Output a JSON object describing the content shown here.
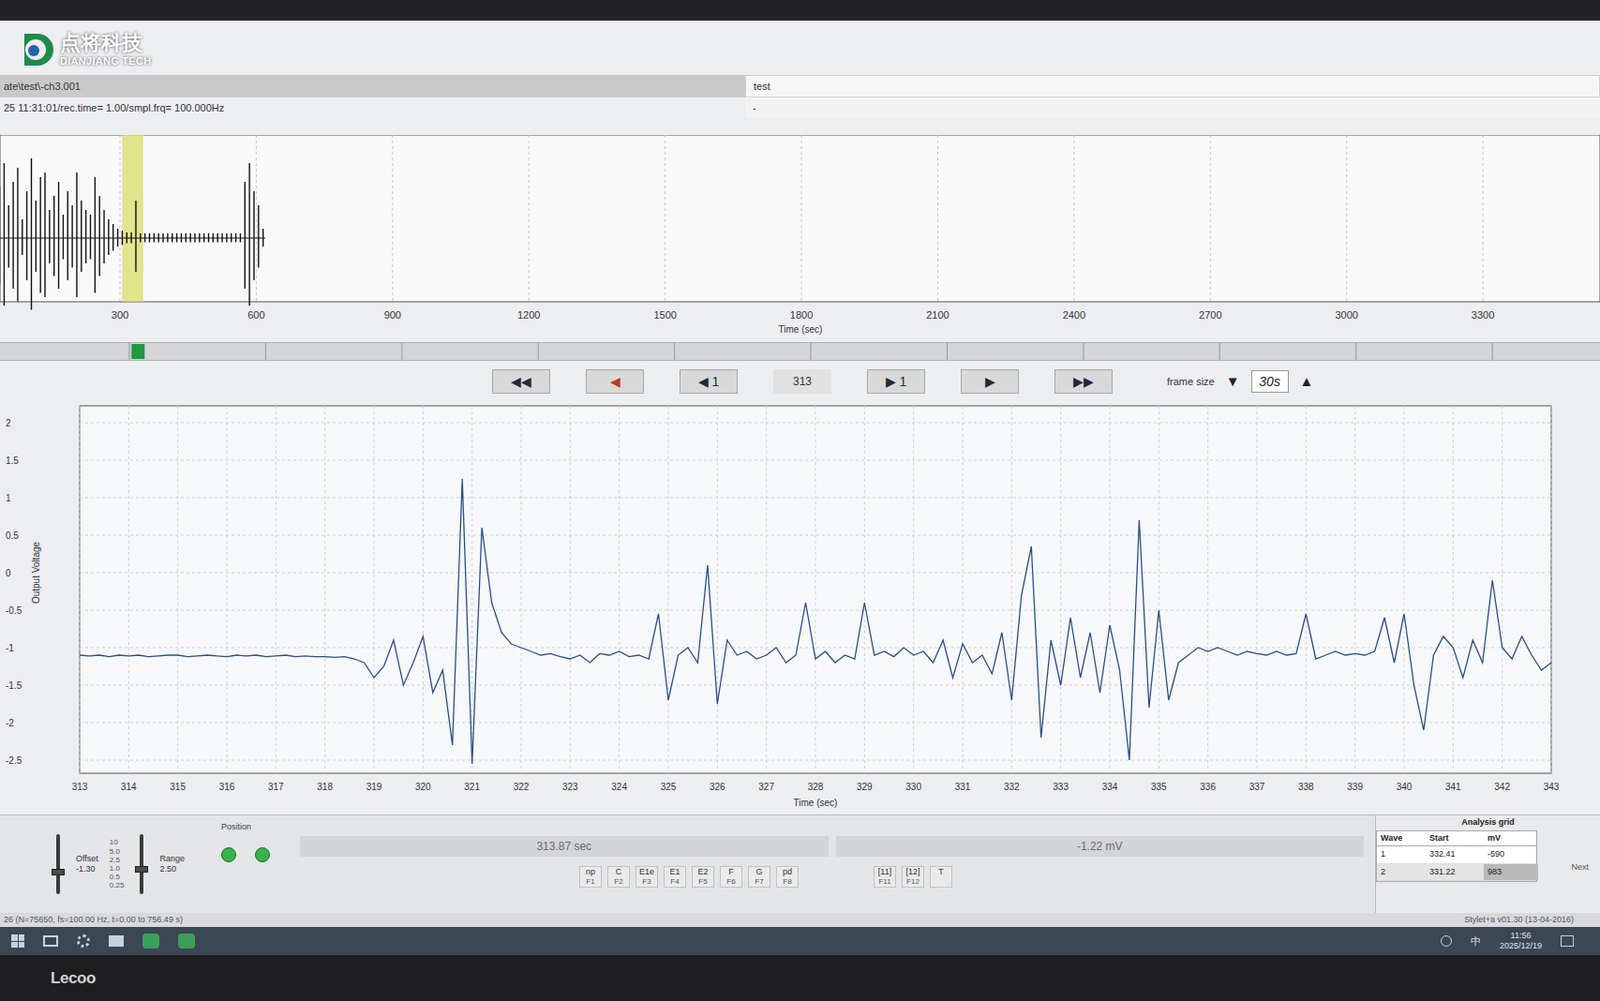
{
  "watermark": {
    "name": "点将科技",
    "subtitle": "DIANJIANG TECH"
  },
  "header": {
    "file": "ate\\test\\-ch3.001",
    "description": "test",
    "info": "25 11:31:01/rec.time= 1.00/smpl.frq= 100.000Hz",
    "note": "-"
  },
  "overview": {
    "ticks": [
      "300",
      "600",
      "900",
      "1200",
      "1500",
      "1800",
      "2100",
      "2400",
      "2700",
      "3000",
      "3300"
    ],
    "axis_label": "Time (sec)",
    "values": [
      40,
      70,
      30,
      55,
      80,
      35,
      60,
      75,
      20,
      50,
      85,
      40,
      65,
      70,
      30,
      45,
      60,
      25,
      50,
      35,
      70,
      40,
      30,
      25,
      65,
      45,
      30,
      20,
      15,
      10,
      8,
      6,
      6,
      40,
      5,
      5,
      5,
      5,
      5,
      5,
      5,
      5,
      5,
      5,
      5,
      5,
      5,
      5,
      5,
      5,
      5,
      5,
      5,
      5,
      5,
      5,
      5,
      60,
      80,
      50,
      35,
      10
    ]
  },
  "navigation": {
    "buttons": [
      {
        "label": "◀◀",
        "color": "#1f2937"
      },
      {
        "label": "◀",
        "color": "#c0392b"
      },
      {
        "label": "◀ 1",
        "color": "#1f2937"
      }
    ],
    "position": "313",
    "forward_buttons": [
      {
        "label": "▶ 1",
        "color": "#1f2937"
      },
      {
        "label": "▶",
        "color": "#1f2937"
      },
      {
        "label": "▶▶",
        "color": "#1f2937"
      }
    ],
    "frame_size_label": "frame size",
    "frame_down": "▼",
    "frame_size": "30s",
    "frame_up": "▲"
  },
  "main_chart": {
    "y_label": "Output Voltage",
    "y_ticks": [
      "2",
      "1.5",
      "1",
      "0.5",
      "0",
      "-0.5",
      "-1",
      "-1.5",
      "-2",
      "-2.5"
    ],
    "x_ticks": [
      "313",
      "314",
      "315",
      "316",
      "317",
      "318",
      "319",
      "320",
      "321",
      "322",
      "323",
      "324",
      "325",
      "326",
      "327",
      "328",
      "329",
      "330",
      "331",
      "332",
      "333",
      "334",
      "335",
      "336",
      "337",
      "338",
      "339",
      "340",
      "341",
      "342",
      "343"
    ],
    "x_label": "Time (sec)",
    "values": [
      -1.1,
      -1.11,
      -1.1,
      -1.12,
      -1.1,
      -1.11,
      -1.1,
      -1.12,
      -1.11,
      -1.1,
      -1.1,
      -1.12,
      -1.11,
      -1.1,
      -1.11,
      -1.12,
      -1.1,
      -1.11,
      -1.1,
      -1.12,
      -1.11,
      -1.1,
      -1.12,
      -1.11,
      -1.12,
      -1.12,
      -1.13,
      -1.12,
      -1.15,
      -1.2,
      -1.4,
      -1.25,
      -0.9,
      -1.5,
      -1.2,
      -0.85,
      -1.6,
      -1.3,
      -2.3,
      1.25,
      -2.55,
      0.6,
      -0.4,
      -0.8,
      -0.95,
      -1.0,
      -1.05,
      -1.1,
      -1.08,
      -1.12,
      -1.15,
      -1.1,
      -1.2,
      -1.08,
      -1.1,
      -1.05,
      -1.12,
      -1.1,
      -1.15,
      -0.55,
      -1.7,
      -1.1,
      -1.0,
      -1.2,
      0.1,
      -1.75,
      -0.9,
      -1.1,
      -1.05,
      -1.15,
      -1.1,
      -1.0,
      -1.2,
      -1.1,
      -0.4,
      -1.15,
      -1.05,
      -1.2,
      -1.1,
      -1.15,
      -0.4,
      -1.1,
      -1.05,
      -1.12,
      -1.0,
      -1.1,
      -1.05,
      -1.2,
      -0.9,
      -1.4,
      -0.95,
      -1.2,
      -1.1,
      -1.35,
      -0.8,
      -1.7,
      -0.3,
      0.35,
      -2.2,
      -0.9,
      -1.5,
      -0.6,
      -1.4,
      -0.8,
      -1.6,
      -0.7,
      -1.3,
      -2.5,
      0.7,
      -1.8,
      -0.5,
      -1.7,
      -1.2,
      -1.1,
      -1.0,
      -1.05,
      -1.0,
      -1.05,
      -1.1,
      -1.05,
      -1.08,
      -1.1,
      -1.05,
      -1.1,
      -1.08,
      -0.55,
      -1.15,
      -1.1,
      -1.05,
      -1.1,
      -1.08,
      -1.1,
      -1.05,
      -0.6,
      -1.2,
      -0.55,
      -1.5,
      -2.1,
      -1.1,
      -0.85,
      -1.0,
      -1.4,
      -0.9,
      -1.2,
      -0.1,
      -1.0,
      -1.15,
      -0.85,
      -1.1,
      -1.3,
      -1.2
    ]
  },
  "controls": {
    "offset": {
      "label": "Offset",
      "value": "-1.30",
      "level": 0.35
    },
    "range": {
      "label": "Range",
      "value": "2.50",
      "level": 0.4,
      "scale": [
        "10",
        "5.0",
        "2.5",
        "1.0",
        "0.5",
        "0.25"
      ]
    },
    "position_label": "Position",
    "time_readout": "313.87 sec",
    "voltage_readout": "-1.22 mV",
    "keys": [
      {
        "label": "np",
        "key": "F1"
      },
      {
        "label": "C",
        "key": "F2"
      },
      {
        "label": "E1e",
        "key": "F3"
      },
      {
        "label": "E1",
        "key": "F4"
      },
      {
        "label": "E2",
        "key": "F5"
      },
      {
        "label": "F",
        "key": "F6"
      },
      {
        "label": "G",
        "key": "F7"
      },
      {
        "label": "pd",
        "key": "F8"
      }
    ],
    "extra_keys": [
      {
        "label": "[11]",
        "key": "F11"
      },
      {
        "label": "[12]",
        "key": "F12"
      },
      {
        "label": "T",
        "key": ""
      }
    ]
  },
  "analysis_grid": {
    "title": "Analysis grid",
    "columns": [
      "Wave",
      "Start",
      "mV"
    ],
    "rows": [
      {
        "wave": "1",
        "start": "332.41",
        "mv": "-590",
        "selected": false
      },
      {
        "wave": "2",
        "start": "331.22",
        "mv": "983",
        "selected": true
      }
    ],
    "next": "Next"
  },
  "status_bar": {
    "left": "26 (N=75650, fs=100.00 Hz, t=0.00 to 756.49 s)",
    "right": "Stylet+a v01.30 (13-04-2016)"
  },
  "taskbar": {
    "ime": "中",
    "time": "11:56",
    "date": "2025/12/19"
  },
  "monitor": {
    "brand": "Lecoo"
  }
}
